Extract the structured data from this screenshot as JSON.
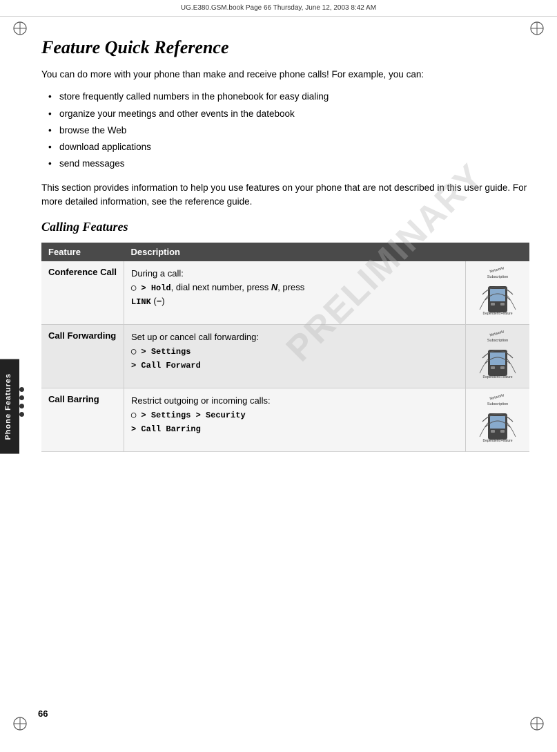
{
  "header": {
    "text": "UG.E380.GSM.book  Page 66  Thursday, June 12, 2003  8:42 AM"
  },
  "page_number": "66",
  "watermark": "PRELIMINARY",
  "side_tab": "Phone Features",
  "title": "Feature Quick Reference",
  "intro_paragraph": "You can do more with your phone than make and receive phone calls! For example, you can:",
  "bullet_items": [
    "store frequently called numbers in the phonebook for easy dialing",
    "organize your meetings and other events in the datebook",
    "browse the Web",
    "download applications",
    "send messages"
  ],
  "section_paragraph": "This section provides information to help you use features on your phone that are not described in this user guide. For more detailed information, see the reference guide.",
  "subsection_heading": "Calling Features",
  "table": {
    "headers": [
      "Feature",
      "Description"
    ],
    "rows": [
      {
        "feature": "Conference Call",
        "description_lines": [
          "During a call:",
          "M > Hold, dial next number, press N, press LINK (−)"
        ],
        "has_icon": true
      },
      {
        "feature": "Call Forwarding",
        "description_lines": [
          "Set up or cancel call forwarding:",
          "M > Settings > Call Forward"
        ],
        "has_icon": true
      },
      {
        "feature": "Call Barring",
        "description_lines": [
          "Restrict outgoing or incoming calls:",
          "M > Settings > Security > Call Barring"
        ],
        "has_icon": true
      }
    ]
  }
}
